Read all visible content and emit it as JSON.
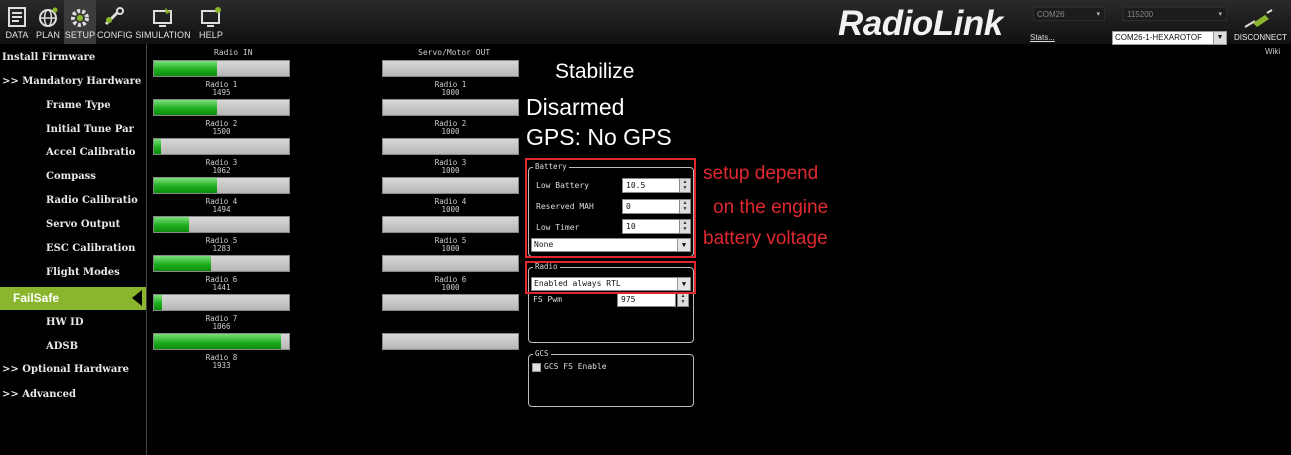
{
  "toolbar": [
    {
      "label": "DATA"
    },
    {
      "label": "PLAN"
    },
    {
      "label": "SETUP"
    },
    {
      "label": "CONFIG"
    },
    {
      "label": "SIMULATION"
    },
    {
      "label": "HELP"
    }
  ],
  "brand": "RadioLink",
  "stats_link": "Stats...",
  "port": "COM26",
  "baud": "115200",
  "vehicle": "COM26-1-HEXAROTOF",
  "disconnect_label": "DISCONNECT",
  "wiki_link": "Wiki",
  "sidebar": {
    "install_firmware": "Install Firmware",
    "mandatory_hardware": ">> Mandatory Hardware",
    "items": [
      "Frame Type",
      "Initial Tune Par",
      "Accel Calibratio",
      "Compass",
      "Radio Calibratio",
      "Servo Output",
      "ESC Calibration",
      "Flight Modes"
    ],
    "active_item": "FailSafe",
    "items_after": [
      "HW ID",
      "ADSB"
    ],
    "optional_hardware": ">> Optional Hardware",
    "advanced": ">> Advanced"
  },
  "radio_in": {
    "header": "Radio IN",
    "channels": [
      {
        "label": "Radio 1",
        "value": "1495",
        "fill": 0.47
      },
      {
        "label": "Radio 2",
        "value": "1500",
        "fill": 0.47
      },
      {
        "label": "Radio 3",
        "value": "1062",
        "fill": 0.05
      },
      {
        "label": "Radio 4",
        "value": "1494",
        "fill": 0.47
      },
      {
        "label": "Radio 5",
        "value": "1283",
        "fill": 0.26
      },
      {
        "label": "Radio 6",
        "value": "1441",
        "fill": 0.42
      },
      {
        "label": "Radio 7",
        "value": "1066",
        "fill": 0.06
      },
      {
        "label": "Radio 8",
        "value": "1933",
        "fill": 0.94
      }
    ]
  },
  "servo_out": {
    "header": "Servo/Motor OUT",
    "channels": [
      {
        "label": "Radio 1",
        "value": "1000"
      },
      {
        "label": "Radio 2",
        "value": "1000"
      },
      {
        "label": "Radio 3",
        "value": "1000"
      },
      {
        "label": "Radio 4",
        "value": "1000"
      },
      {
        "label": "Radio 5",
        "value": "1000"
      },
      {
        "label": "Radio 6",
        "value": "1000"
      },
      {
        "label": "",
        "value": ""
      },
      {
        "label": "",
        "value": ""
      }
    ]
  },
  "status": {
    "mode": "Stabilize",
    "armed": "Disarmed",
    "gps": "GPS: No GPS"
  },
  "battery": {
    "title": "Battery",
    "low_battery_label": "Low Battery",
    "low_battery_value": "10.5",
    "reserved_mah_label": "Reserved MAH",
    "reserved_mah_value": "0",
    "low_timer_label": "Low Timer",
    "low_timer_value": "10",
    "action": "None"
  },
  "radio": {
    "title": "Radio",
    "action": "Enabled always RTL",
    "fs_pwm_label": "FS Pwm",
    "fs_pwm_value": "975"
  },
  "gcs": {
    "title": "GCS",
    "enable_label": "GCS FS Enable"
  },
  "annotation": {
    "line1": "setup depend",
    "line2": "on the engine",
    "line3": "battery voltage"
  }
}
